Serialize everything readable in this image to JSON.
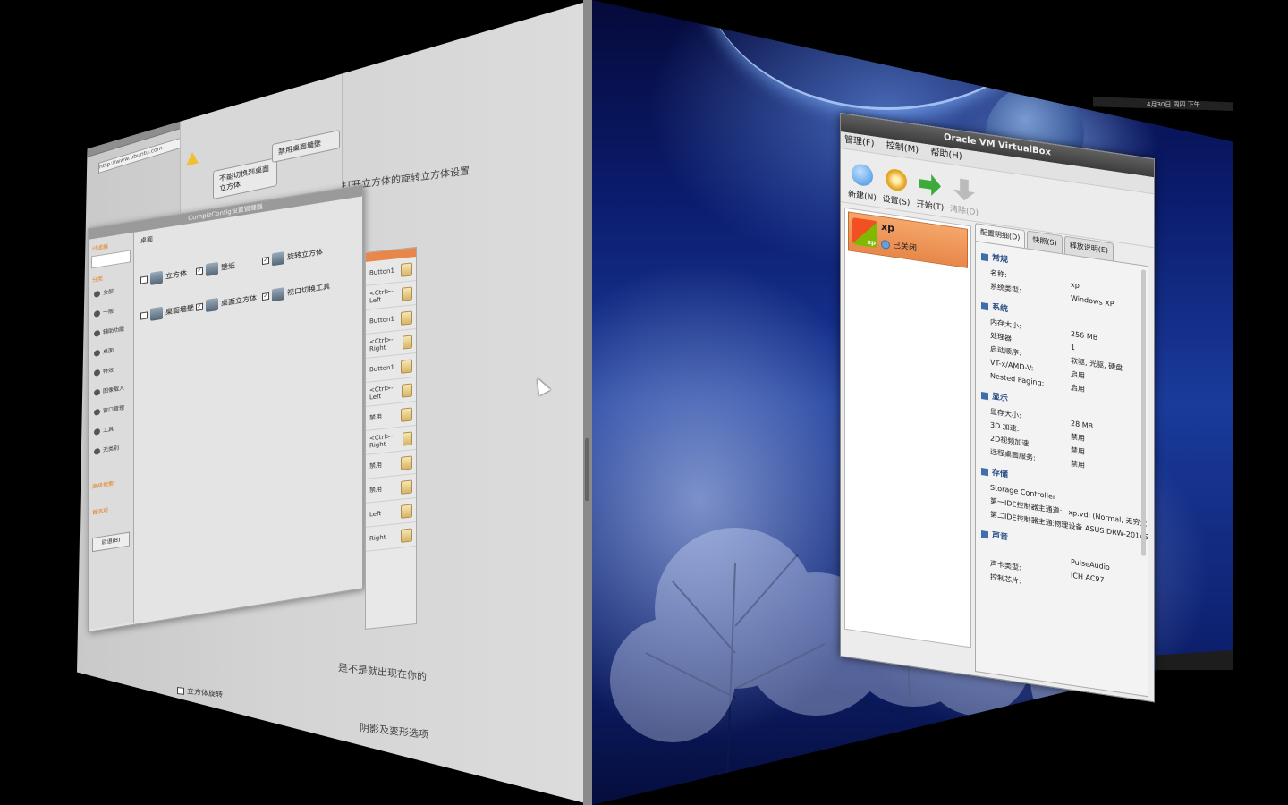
{
  "left_face": {
    "browser": {
      "tabs": [
        "bitub - Compiz",
        "Compiz配置...",
        "发布"
      ],
      "address": "http://www.ubuntu.com"
    },
    "warning_buttons": {
      "disable_label": "不能切换到桌面立方体",
      "settings_label": "禁用桌面墙壁"
    },
    "article": {
      "line1": "打开立方体的旋转立方体设置",
      "line2": "是不是就出现在你的",
      "line3": "阴影及变形选项",
      "checkbox_label": "立方体旋转"
    },
    "ccsm": {
      "title": "CompizConfig设置管理器",
      "search_placeholder": "过滤器",
      "side_header": "分类",
      "side_items": [
        "全部",
        "一般",
        "辅助功能",
        "桌面",
        "特效",
        "图像载入",
        "窗口管理",
        "工具",
        "无类别"
      ],
      "advanced_label": "高级搜索",
      "prefs_label": "首选项",
      "back_label": "后退(B)",
      "section_title": "桌面",
      "plugins": [
        {
          "label": "立方体",
          "checked": false
        },
        {
          "label": "壁纸",
          "checked": true
        },
        {
          "label": "旋转立方体",
          "checked": true
        },
        {
          "label": "桌面墙壁",
          "checked": false
        },
        {
          "label": "桌面立方体",
          "checked": true
        },
        {
          "label": "视口切换工具",
          "checked": true
        }
      ]
    },
    "key_rows": [
      "Button1",
      "<Ctrl>-Left",
      "Button1",
      "<Ctrl>-Right",
      "Button1",
      "<Ctrl>-Left",
      "禁用",
      "<Ctrl>-Right",
      "禁用",
      "禁用",
      "Left",
      "Right"
    ]
  },
  "right_face": {
    "vbox": {
      "title": "Oracle VM VirtualBox",
      "menu": [
        "管理(F)",
        "控制(M)",
        "帮助(H)"
      ],
      "toolbar": [
        {
          "label": "新建(N)",
          "color": "#3d8ede",
          "enabled": true
        },
        {
          "label": "设置(S)",
          "color": "#e3a526",
          "enabled": true
        },
        {
          "label": "开始(T)",
          "color": "#3caa3c",
          "enabled": true
        },
        {
          "label": "清除(D)",
          "color": "#bbbbbb",
          "enabled": false
        }
      ],
      "vm": {
        "name": "xp",
        "state": "已关闭"
      },
      "tabs": [
        "配置明细(D)",
        "快照(S)",
        "释放说明(E)"
      ],
      "sections": [
        {
          "title": "常规",
          "rows": [
            [
              "名称:",
              "xp"
            ],
            [
              "系统类型:",
              "Windows XP"
            ]
          ]
        },
        {
          "title": "系统",
          "rows": [
            [
              "内存大小:",
              "256 MB"
            ],
            [
              "处理器:",
              "1"
            ],
            [
              "启动顺序:",
              "软驱, 光驱, 硬盘"
            ],
            [
              "VT-x/AMD-V:",
              "启用"
            ],
            [
              "Nested Paging:",
              "启用"
            ]
          ]
        },
        {
          "title": "显示",
          "rows": [
            [
              "显存大小:",
              "28 MB"
            ],
            [
              "3D 加速:",
              "禁用"
            ],
            [
              "2D视频加速:",
              "禁用"
            ],
            [
              "远程桌面服务:",
              "禁用"
            ]
          ]
        },
        {
          "title": "存储",
          "rows": [
            [
              "Storage Controller",
              ""
            ],
            [
              "第一IDE控制器主通道:",
              "xp.vdi (Normal, 无穷大)"
            ],
            [
              "第二IDE控制器主通道 (光驱):",
              "物理设备 ASUS DRW-2014S1 (srx)"
            ]
          ]
        },
        {
          "title": "声音",
          "rows": [
            [
              "",
              "PulseAudio"
            ],
            [
              "声卡类型:",
              "ICH AC97"
            ],
            [
              "控制芯片:",
              ""
            ]
          ]
        }
      ]
    },
    "panel_text": "4月30日 周四 下午"
  }
}
